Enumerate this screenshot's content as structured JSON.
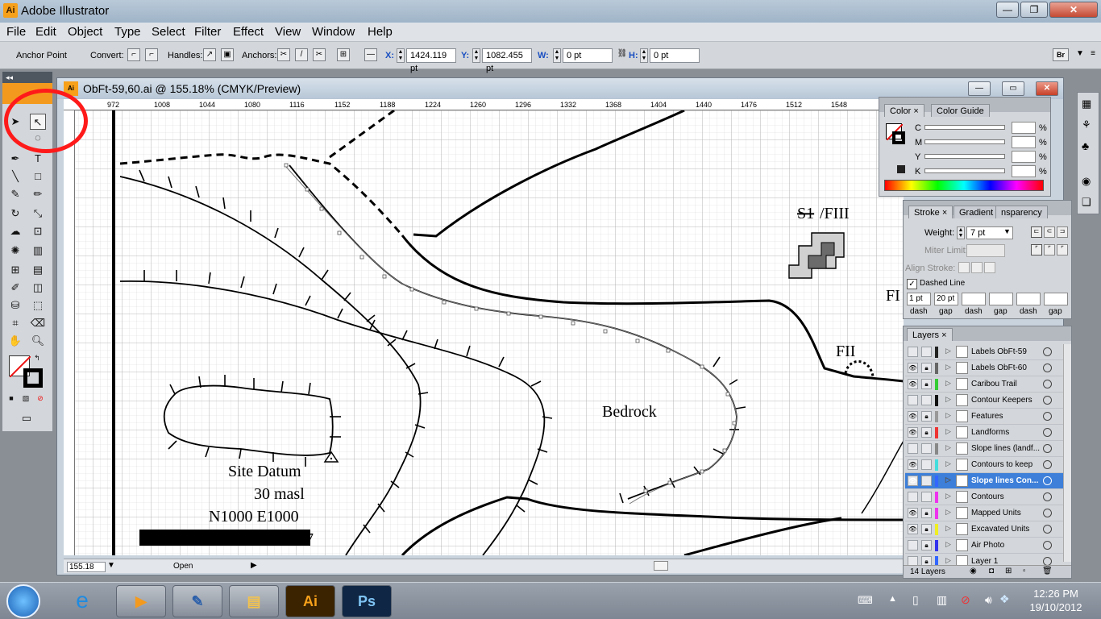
{
  "app": {
    "title": "Adobe Illustrator",
    "logo": "Ai"
  },
  "menubar": [
    "File",
    "Edit",
    "Object",
    "Type",
    "Select",
    "Filter",
    "Effect",
    "View",
    "Window",
    "Help"
  ],
  "controlbar": {
    "anchor_point": "Anchor Point",
    "convert": "Convert:",
    "handles": "Handles:",
    "anchors": "Anchors:",
    "x_label": "X:",
    "x_value": "1424.119 pt",
    "y_label": "Y:",
    "y_value": "1082.455 pt",
    "w_label": "W:",
    "w_value": "0 pt",
    "h_label": "H:",
    "h_value": "0 pt",
    "br": "Br"
  },
  "document": {
    "title": "ObFt-59,60.ai @ 155.18% (CMYK/Preview)",
    "zoom": "155.18",
    "status": "Open"
  },
  "ruler_top": [
    "972",
    "1008",
    "1044",
    "1080",
    "1116",
    "1152",
    "1188",
    "1224",
    "1260",
    "1296",
    "1332",
    "1368",
    "1404",
    "1440",
    "1476",
    "1512",
    "1548"
  ],
  "map_labels": {
    "site_datum": "Site Datum",
    "masl": "30 masl",
    "coords": "N1000 E1000",
    "bedrock": "Bedrock",
    "s1": "S1",
    "fiii": "/FIII",
    "fii": "FII",
    "fi": "FI",
    "seven": "7"
  },
  "color_panel": {
    "tabs": [
      "Color",
      "Color Guide"
    ],
    "channels": [
      "C",
      "M",
      "Y",
      "K"
    ],
    "pct": "%"
  },
  "stroke_panel": {
    "tabs": [
      "Stroke",
      "Gradient",
      "nsparency"
    ],
    "weight_label": "Weight:",
    "weight_value": "7 pt",
    "miter_label": "Miter Limit:",
    "align_label": "Align Stroke:",
    "dashed_label": "Dashed Line",
    "dash1": "1 pt",
    "gap1": "20 pt",
    "dash_label": "dash",
    "gap_label": "gap"
  },
  "layers_panel": {
    "tab": "Layers",
    "count": "14 Layers",
    "layers": [
      {
        "name": "Labels ObFt-59",
        "color": "#222222",
        "eye": false,
        "lock": false,
        "active": false
      },
      {
        "name": "Labels ObFt-60",
        "color": "#666666",
        "eye": true,
        "lock": true,
        "active": false
      },
      {
        "name": "Caribou Trail",
        "color": "#33cc33",
        "eye": true,
        "lock": true,
        "active": false
      },
      {
        "name": "Contour Keepers",
        "color": "#111111",
        "eye": false,
        "lock": false,
        "active": false
      },
      {
        "name": "Features",
        "color": "#999999",
        "eye": true,
        "lock": true,
        "active": false
      },
      {
        "name": "Landforms",
        "color": "#ee3333",
        "eye": true,
        "lock": true,
        "active": false
      },
      {
        "name": "Slope lines (landf...",
        "color": "#888888",
        "eye": false,
        "lock": false,
        "active": false
      },
      {
        "name": "Contours to keep",
        "color": "#44dddd",
        "eye": true,
        "lock": false,
        "active": false
      },
      {
        "name": "Slope lines Con...",
        "color": "#3366ff",
        "eye": true,
        "lock": false,
        "active": true
      },
      {
        "name": "Contours",
        "color": "#ee33ee",
        "eye": false,
        "lock": false,
        "active": false
      },
      {
        "name": "Mapped Units",
        "color": "#ee33ee",
        "eye": true,
        "lock": true,
        "active": false
      },
      {
        "name": "Excavated Units",
        "color": "#eeee22",
        "eye": true,
        "lock": true,
        "active": false
      },
      {
        "name": "Air Photo",
        "color": "#3333ee",
        "eye": false,
        "lock": true,
        "active": false
      },
      {
        "name": "Layer 1",
        "color": "#3366ff",
        "eye": false,
        "lock": true,
        "active": false
      }
    ]
  },
  "taskbar": {
    "time": "12:26 PM",
    "date": "19/10/2012",
    "ai": "Ai",
    "ps": "Ps"
  }
}
